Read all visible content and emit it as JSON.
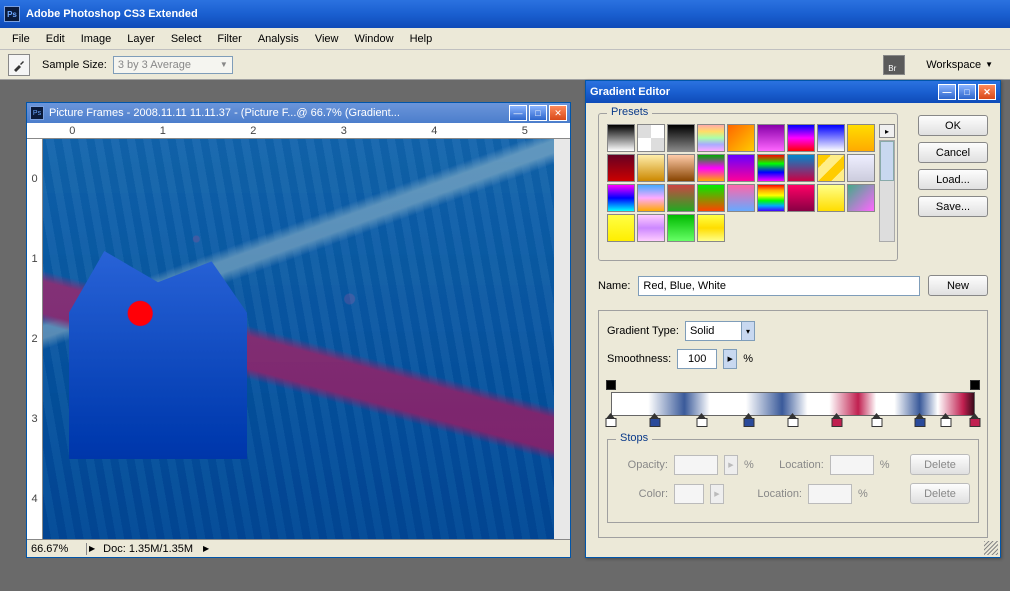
{
  "app": {
    "title": "Adobe Photoshop CS3 Extended",
    "icon_text": "Ps"
  },
  "menu": [
    "File",
    "Edit",
    "Image",
    "Layer",
    "Select",
    "Filter",
    "Analysis",
    "View",
    "Window",
    "Help"
  ],
  "options": {
    "sample_label": "Sample Size:",
    "sample_value": "3 by 3 Average",
    "workspace_label": "Workspace"
  },
  "doc": {
    "title": "Picture Frames - 2008.11.11 11.11.37 - (Picture F...@ 66.7% (Gradient...",
    "ruler_h": [
      "0",
      "1",
      "2",
      "3",
      "4",
      "5"
    ],
    "ruler_v": [
      "0",
      "1",
      "2",
      "3",
      "4"
    ],
    "zoom": "66.67%",
    "docsize": "Doc: 1.35M/1.35M"
  },
  "grad": {
    "title": "Gradient Editor",
    "presets_label": "Presets",
    "name_label": "Name:",
    "name_value": "Red, Blue, White",
    "type_label": "Gradient Type:",
    "type_value": "Solid",
    "smooth_label": "Smoothness:",
    "smooth_value": "100",
    "pct": "%",
    "stops_label": "Stops",
    "opacity_label": "Opacity:",
    "color_label": "Color:",
    "location_label": "Location:",
    "delete_label": "Delete",
    "buttons": {
      "ok": "OK",
      "cancel": "Cancel",
      "load": "Load...",
      "save": "Save...",
      "new": "New"
    },
    "swatches": [
      "linear-gradient(#000,#fff)",
      "repeating-conic-gradient(#fff 0 25%,#ddd 0 50%)",
      "linear-gradient(#000,#888)",
      "linear-gradient(#faa,#fd6,#afa,#aaf,#faf)",
      "linear-gradient(135deg,#f60,#fc0)",
      "linear-gradient(#80a,#f6f)",
      "linear-gradient(#00f,#f0f,#f00)",
      "linear-gradient(#00f,#fff)",
      "linear-gradient(#fd0,#fa0)",
      "linear-gradient(#602,#c00)",
      "linear-gradient(#fea,#c80)",
      "linear-gradient(#fca,#840)",
      "linear-gradient(#0a0,#f0f,#fa0)",
      "linear-gradient(#60f,#f09)",
      "linear-gradient(#f00,#0f0,#00f,#f0f)",
      "linear-gradient(#08c,#c04)",
      "linear-gradient(135deg,#fc0 0 25%,#fe8 25% 50%,#fc0 50% 75%,#fe8 75%)",
      "linear-gradient(#eef,#ccd)",
      "linear-gradient(#f0f,#00f,#0ff)",
      "linear-gradient(#4af,#faf,#fa0)",
      "linear-gradient(#c44,#2a2)",
      "linear-gradient(#0e0,#f40)",
      "linear-gradient(#f6a,#6af)",
      "linear-gradient(#f00,#fa0,#ff0,#0f0,#0af,#40f)",
      "linear-gradient(#f06,#804)",
      "linear-gradient(#ff8,#fd0)",
      "linear-gradient(135deg,#4a8,#f6f)",
      "linear-gradient(#ff4,#fe0)",
      "linear-gradient(#fcf,#c8f,#fcf)",
      "linear-gradient(#0b0,#6f6)",
      "linear-gradient(#ff4,#fd0,#ff8)"
    ],
    "color_stops": [
      {
        "pos": 0,
        "cls": ""
      },
      {
        "pos": 12,
        "cls": "blue"
      },
      {
        "pos": 25,
        "cls": ""
      },
      {
        "pos": 38,
        "cls": "blue"
      },
      {
        "pos": 50,
        "cls": ""
      },
      {
        "pos": 62,
        "cls": "red"
      },
      {
        "pos": 73,
        "cls": ""
      },
      {
        "pos": 85,
        "cls": "blue"
      },
      {
        "pos": 92,
        "cls": ""
      },
      {
        "pos": 100,
        "cls": "red"
      }
    ]
  }
}
